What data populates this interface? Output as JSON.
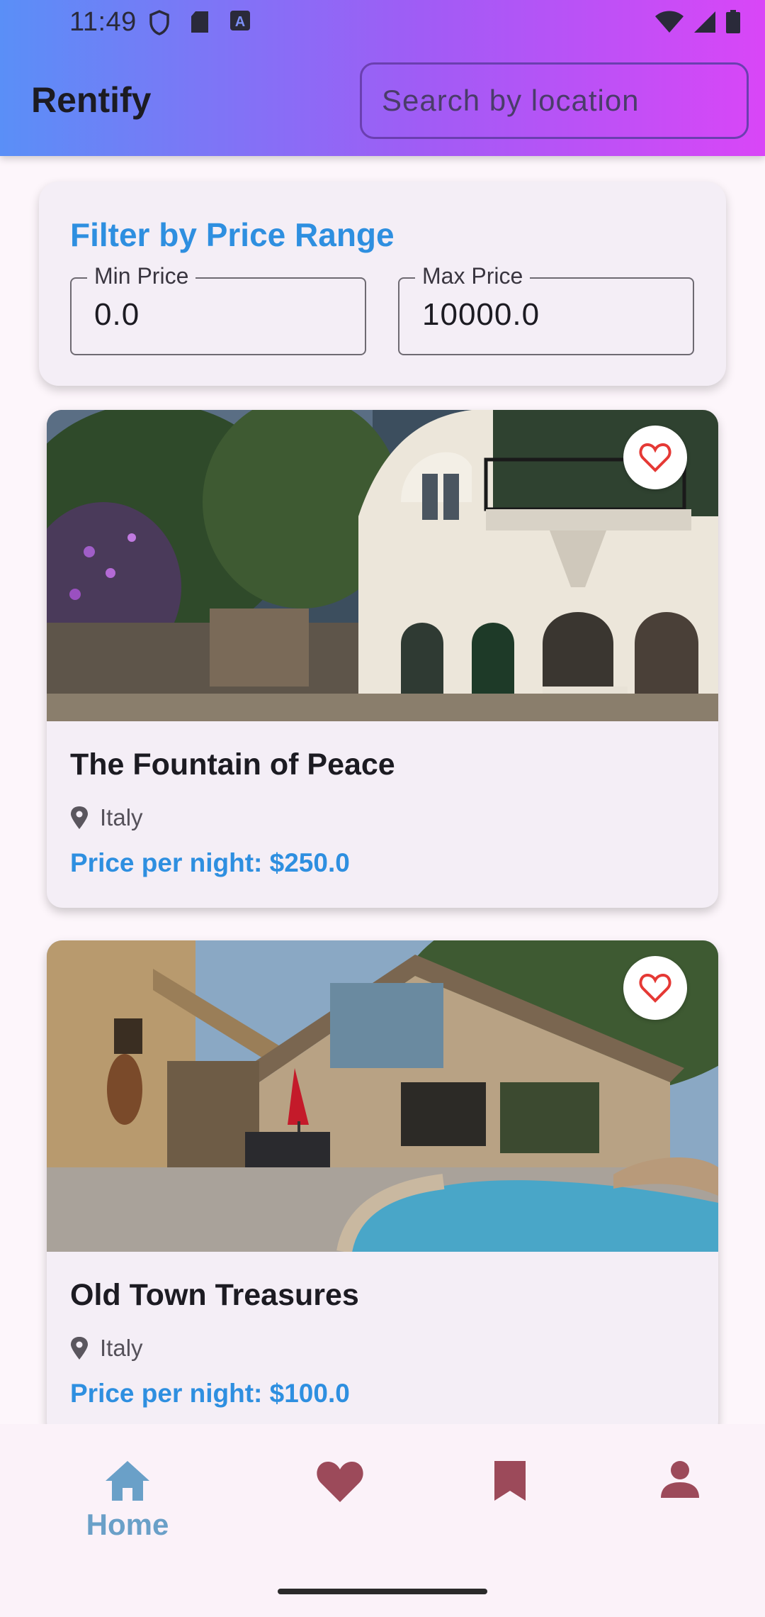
{
  "status_bar": {
    "time": "11:49"
  },
  "app_bar": {
    "title": "Rentify",
    "search_placeholder": "Search by location"
  },
  "filter": {
    "title": "Filter by Price Range",
    "min_label": "Min Price",
    "min_value": "0.0",
    "max_label": "Max Price",
    "max_value": "10000.0"
  },
  "listings": [
    {
      "name": "The Fountain of Peace",
      "location": "Italy",
      "price": "Price per night: $250.0"
    },
    {
      "name": "Old Town Treasures",
      "location": "Italy",
      "price": "Price per night: $100.0"
    }
  ],
  "bottom_nav": {
    "items": [
      {
        "label": "Home",
        "icon": "home-icon",
        "active": true
      },
      {
        "label": "",
        "icon": "heart-icon",
        "active": false
      },
      {
        "label": "",
        "icon": "bookmark-icon",
        "active": false
      },
      {
        "label": "",
        "icon": "person-icon",
        "active": false
      }
    ]
  },
  "colors": {
    "accent_blue": "#2e8fe0",
    "nav_active": "#6aa0c8",
    "nav_inactive": "#9c4a5a",
    "fav_heart": "#e53935"
  }
}
